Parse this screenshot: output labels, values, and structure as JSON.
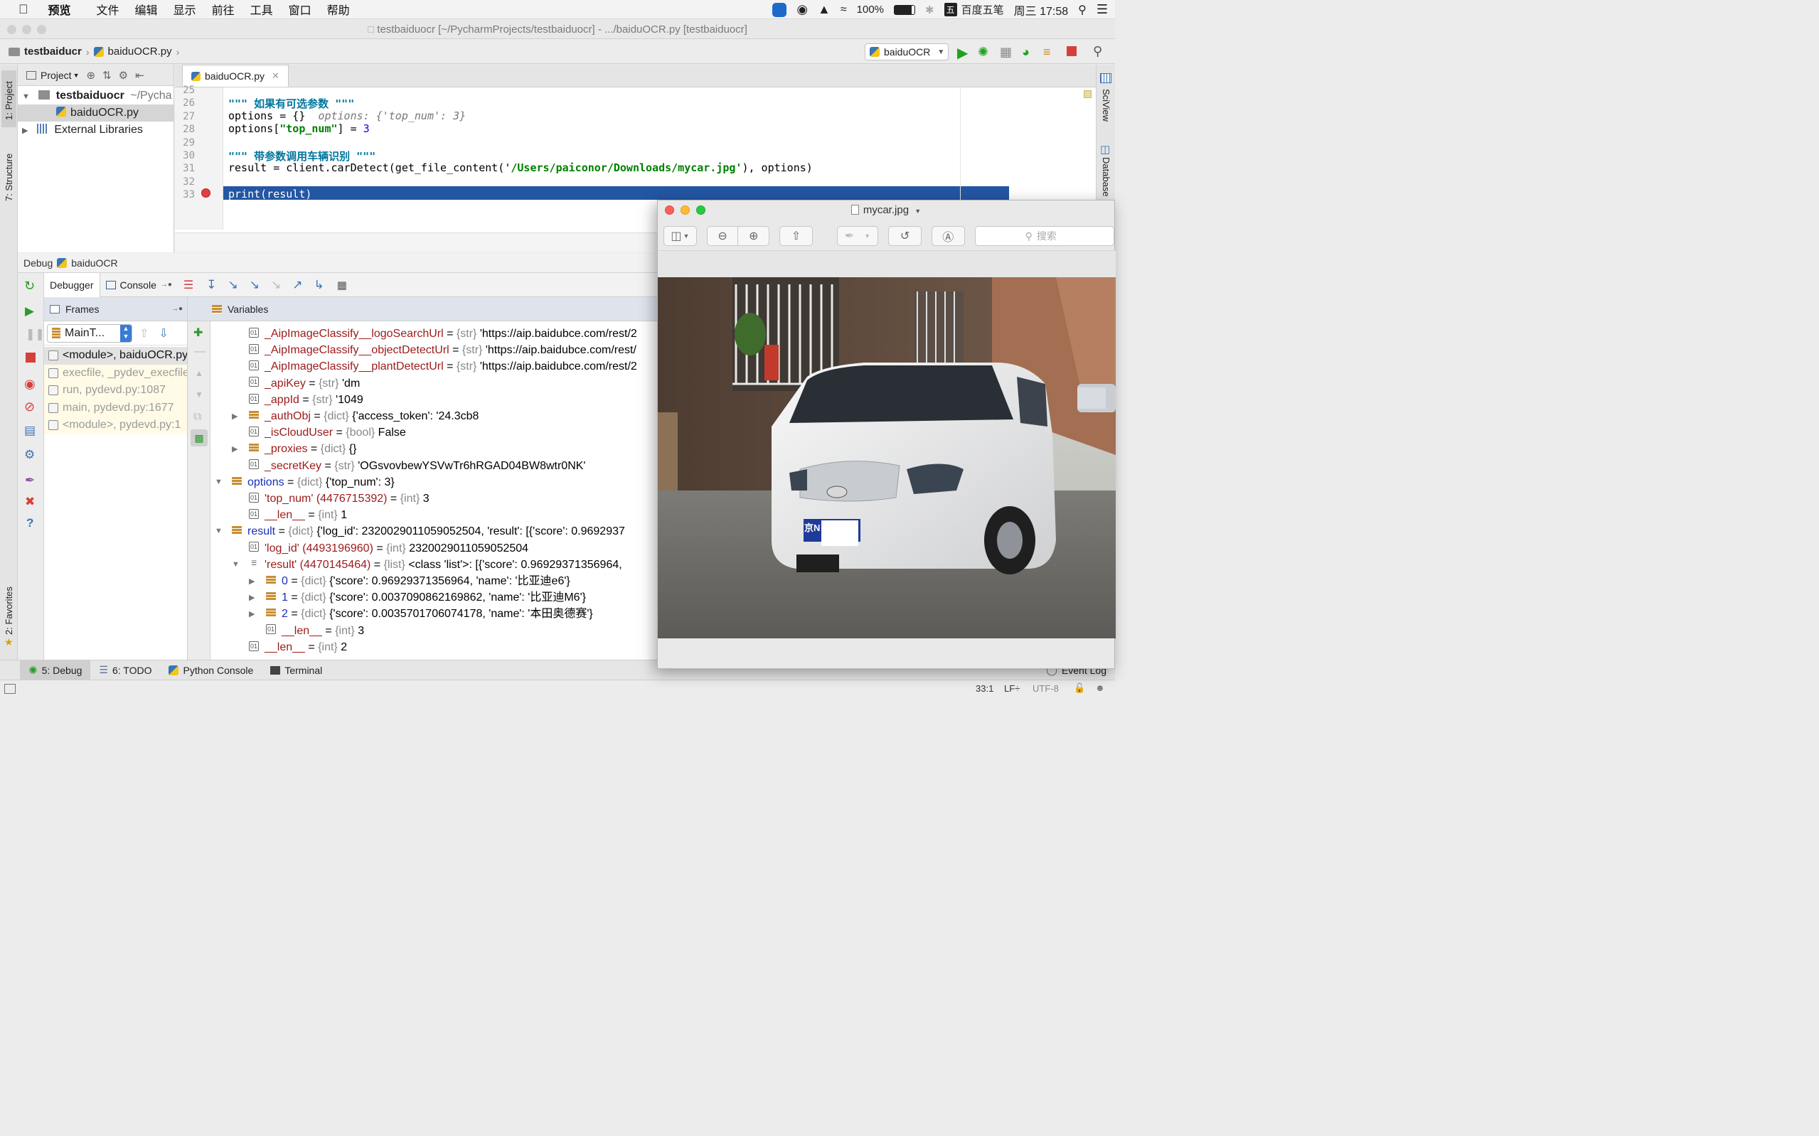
{
  "menubar": {
    "app": "预览",
    "items": [
      "文件",
      "编辑",
      "显示",
      "前往",
      "工具",
      "窗口",
      "帮助"
    ],
    "battery": "100%",
    "ime": "百度五笔",
    "ime_badge": "五",
    "clock": "周三 17:58"
  },
  "window": {
    "title": "testbaiduocr [~/PycharmProjects/testbaiduocr] - .../baiduOCR.py [testbaiduocr]"
  },
  "nav": {
    "crumb1": "testbaiducr",
    "crumb2": "baiduOCR.py",
    "run_config": "baiduOCR"
  },
  "left_tabs": {
    "project": "1: Project",
    "structure": "7: Structure",
    "favorites": "2: Favorites"
  },
  "right_tabs": {
    "sciview": "SciView",
    "database": "Database"
  },
  "project": {
    "header": "Project",
    "root": "testbaiduocr",
    "root_path": "~/Pycha",
    "file": "baiduOCR.py",
    "ext": "External Libraries"
  },
  "editor": {
    "tab": "baiduOCR.py",
    "lines": [
      {
        "n": "25",
        "code": ""
      },
      {
        "n": "26",
        "doc": "\"\"\" 如果有可选参数 \"\"\""
      },
      {
        "n": "27",
        "pre": "options = {}  ",
        "hint": "options: {'top_num': 3}"
      },
      {
        "n": "28",
        "pre": "options[",
        "s": "\"top_num\"",
        "mid": "] = ",
        "num": "3"
      },
      {
        "n": "29",
        "code": ""
      },
      {
        "n": "30",
        "doc": "\"\"\" 带参数调用车辆识别 \"\"\""
      },
      {
        "n": "31",
        "pre": "result = client.carDetect(get_file_content(",
        "s": "'/Users/paiconor/Downloads/mycar.jpg'",
        "mid": "), options)"
      },
      {
        "n": "32",
        "code": ""
      },
      {
        "n": "33",
        "code": "print(result)"
      }
    ]
  },
  "debug": {
    "title": "Debug",
    "config": "baiduOCR",
    "tab_debugger": "Debugger",
    "tab_console": "Console",
    "frames_label": "Frames",
    "variables_label": "Variables",
    "thread": "MainT...",
    "frames": [
      "<module>, baiduOCR.py",
      "execfile, _pydev_execfile",
      "run, pydevd.py:1087",
      "main, pydevd.py:1677",
      "<module>, pydevd.py:1"
    ],
    "vars": [
      {
        "name": "_AipImageClassify__logoSearchUrl",
        "type": "{str}",
        "val": "'https://aip.baidubce.com/rest/2"
      },
      {
        "name": "_AipImageClassify__objectDetectUrl",
        "type": "{str}",
        "val": "'https://aip.baidubce.com/rest/"
      },
      {
        "name": "_AipImageClassify__plantDetectUrl",
        "type": "{str}",
        "val": "'https://aip.baidubce.com/rest/2"
      },
      {
        "name": "_apiKey",
        "type": "{str}",
        "val": "'dm"
      },
      {
        "name": "_appId",
        "type": "{str}",
        "val": "'1049"
      },
      {
        "name": "_authObj",
        "type": "{dict}",
        "val": "{'access_token': '24.3cb8"
      },
      {
        "name": "_isCloudUser",
        "type": "{bool}",
        "val": "False"
      },
      {
        "name": "_proxies",
        "type": "{dict}",
        "val": "{}"
      },
      {
        "name": "_secretKey",
        "type": "{str}",
        "val": "'OGsvovbewYSVwTr6hRGAD04BW8wtr0NK'"
      },
      {
        "name": "options",
        "type": "{dict}",
        "val": "{'top_num': 3}"
      },
      {
        "name": "'top_num' (4476715392)",
        "type": "{int}",
        "val": "3"
      },
      {
        "name": "__len__",
        "type": "{int}",
        "val": "1"
      },
      {
        "name": "result",
        "type": "{dict}",
        "val": "{'log_id': 2320029011059052504, 'result': [{'score': 0.9692937"
      },
      {
        "name": "'log_id' (4493196960)",
        "type": "{int}",
        "val": "2320029011059052504"
      },
      {
        "name": "'result' (4470145464)",
        "type": "{list}",
        "val": "<class 'list'>: [{'score': 0.96929371356964,"
      },
      {
        "name": "0",
        "type": "{dict}",
        "val": "{'score': 0.96929371356964, 'name': '比亚迪e6'}"
      },
      {
        "name": "1",
        "type": "{dict}",
        "val": "{'score': 0.0037090862169862, 'name': '比亚迪M6'}"
      },
      {
        "name": "2",
        "type": "{dict}",
        "val": "{'score': 0.0035701706074178, 'name': '本田奥德赛'}"
      },
      {
        "name": "__len__",
        "type": "{int}",
        "val": "3"
      },
      {
        "name": "__len__",
        "type": "{int}",
        "val": "2"
      }
    ]
  },
  "bottom": {
    "debug": "5: Debug",
    "todo": "6: TODO",
    "pyconsole": "Python Console",
    "terminal": "Terminal",
    "eventlog": "Event Log"
  },
  "status": {
    "pos": "33:1",
    "lf": "LF÷",
    "enc": "UTF-8"
  },
  "preview": {
    "title": "mycar.jpg",
    "search": "搜索",
    "plate": "京N"
  }
}
